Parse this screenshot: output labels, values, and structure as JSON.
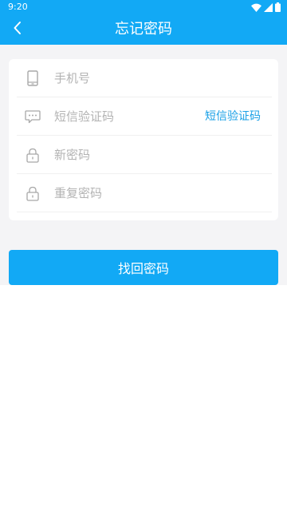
{
  "status_bar": {
    "time": "9:20",
    "icons": [
      "wifi-icon",
      "signal-icon",
      "battery-icon"
    ]
  },
  "header": {
    "back_icon": "back-arrow-icon",
    "title": "忘记密码"
  },
  "form": {
    "phone": {
      "icon": "phone-icon",
      "placeholder": "手机号",
      "value": ""
    },
    "sms_code": {
      "icon": "message-icon",
      "placeholder": "短信验证码",
      "value": "",
      "action_label": "短信验证码"
    },
    "new_password": {
      "icon": "lock-icon",
      "placeholder": "新密码",
      "value": ""
    },
    "repeat_password": {
      "icon": "lock-icon",
      "placeholder": "重复密码",
      "value": ""
    }
  },
  "submit": {
    "label": "找回密码"
  },
  "colors": {
    "primary": "#12a9f5",
    "link": "#1aa0e6",
    "background": "#f4f4f6",
    "placeholder": "#b3b3b3"
  }
}
